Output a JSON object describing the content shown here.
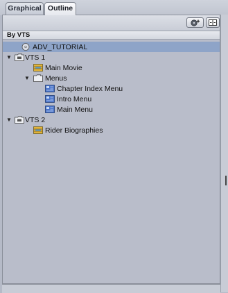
{
  "tabs": [
    {
      "label": "Graphical",
      "active": false
    },
    {
      "label": "Outline",
      "active": true
    }
  ],
  "toolbar": {
    "add_button_icon": "add-disc-icon",
    "split_button_icon": "split-view-icon"
  },
  "section": {
    "title": "By VTS"
  },
  "tree": {
    "items": [
      {
        "label": "ADV_TUTORIAL",
        "icon": "disc-icon",
        "level": 0,
        "expanded": null,
        "selected": true
      },
      {
        "label": "VTS 1",
        "icon": "vts-folder-icon",
        "level": 0,
        "expanded": true,
        "selected": false
      },
      {
        "label": "Main Movie",
        "icon": "movie-icon",
        "level": 1,
        "expanded": null,
        "selected": false
      },
      {
        "label": "Menus",
        "icon": "folder-icon",
        "level": 1,
        "expanded": true,
        "selected": false
      },
      {
        "label": "Chapter Index Menu",
        "icon": "menu-icon",
        "level": 2,
        "expanded": null,
        "selected": false
      },
      {
        "label": "Intro Menu",
        "icon": "menu-icon",
        "level": 2,
        "expanded": null,
        "selected": false
      },
      {
        "label": "Main Menu",
        "icon": "menu-icon",
        "level": 2,
        "expanded": null,
        "selected": false
      },
      {
        "label": "VTS 2",
        "icon": "vts-folder-icon",
        "level": 0,
        "expanded": true,
        "selected": false
      },
      {
        "label": "Rider Biographies",
        "icon": "movie-icon",
        "level": 1,
        "expanded": null,
        "selected": false
      }
    ]
  },
  "colors": {
    "panel_bg": "#b9bdca",
    "selection": "#8ea4c8",
    "folder": "#eef0f4",
    "menu_icon": "#4a74c9",
    "movie_icon": "#e2b43a"
  }
}
